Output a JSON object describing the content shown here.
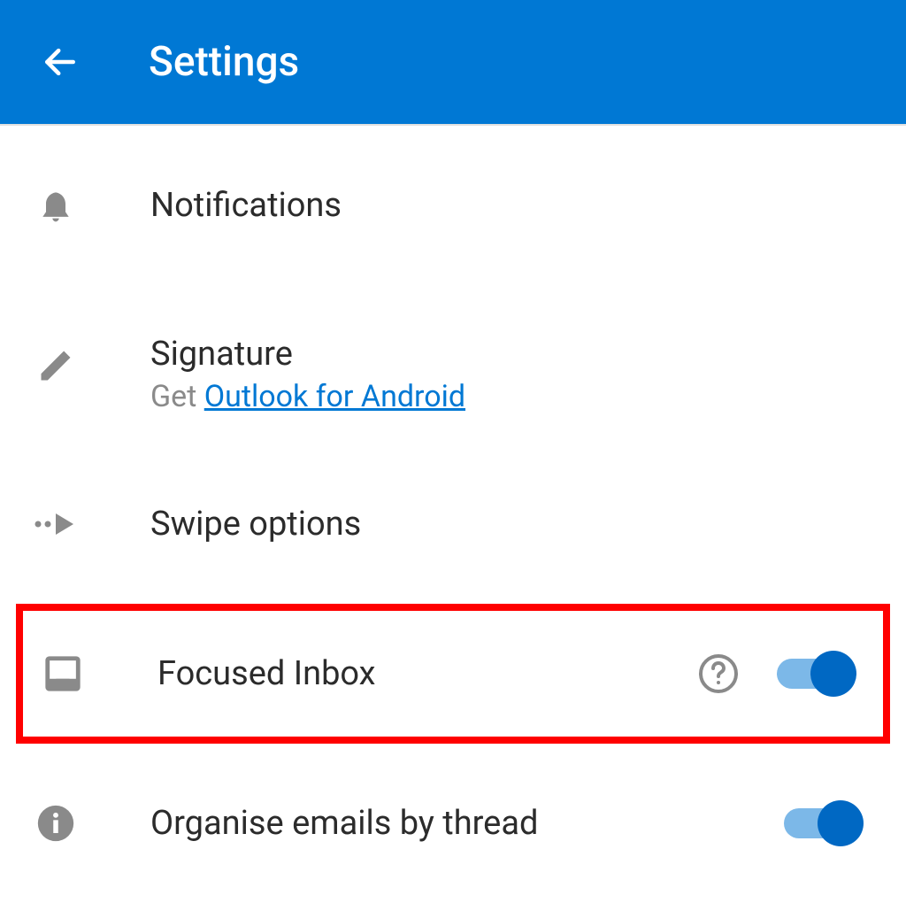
{
  "header": {
    "title": "Settings"
  },
  "items": {
    "notifications": {
      "label": "Notifications"
    },
    "signature": {
      "label": "Signature",
      "subtitle_prefix": "Get ",
      "subtitle_link": "Outlook for Android"
    },
    "swipe_options": {
      "label": "Swipe options"
    },
    "focused_inbox": {
      "label": "Focused Inbox"
    },
    "organise_emails": {
      "label": "Organise emails by thread"
    }
  }
}
